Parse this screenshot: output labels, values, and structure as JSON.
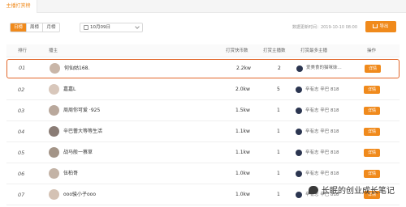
{
  "tabs": [
    {
      "label": "主播打赏榜"
    }
  ],
  "toolbar": {
    "period_options": [
      "日榜",
      "周榜",
      "月榜"
    ],
    "active_period": "日榜",
    "date_value": "10月09日",
    "update_text": "数据更新时间：2019-10-10 08:00",
    "export_label": "导出"
  },
  "table": {
    "headers": [
      "排行",
      "播主",
      "打赏快币数",
      "打赏主播数",
      "打赏最多主播",
      "操作"
    ],
    "rows": [
      {
        "rank": "01",
        "name": "何仙姑168.",
        "coins": "2.2kw",
        "count": "2",
        "top_host": "爱美食的猫咪妹...",
        "action": "详情"
      },
      {
        "rank": "02",
        "name": "嘉嘉L",
        "coins": "2.0kw",
        "count": "5",
        "top_host": "辛有志 辛巴 818",
        "action": "详情"
      },
      {
        "rank": "03",
        "name": "周周你可爱 ·925",
        "coins": "1.5kw",
        "count": "1",
        "top_host": "辛有志 辛巴 818",
        "action": "详情"
      },
      {
        "rank": "04",
        "name": "辛巴蕾大等等生活",
        "coins": "1.1kw",
        "count": "1",
        "top_host": "辛有志 辛巴 818",
        "action": "详情"
      },
      {
        "rank": "05",
        "name": "战马般一蔡草",
        "coins": "1.1kw",
        "count": "1",
        "top_host": "辛有志 辛巴 818",
        "action": "详情"
      },
      {
        "rank": "06",
        "name": "伍柏哥",
        "coins": "1.0kw",
        "count": "1",
        "top_host": "辛有志 辛巴 818",
        "action": "详情"
      },
      {
        "rank": "07",
        "name": "ooo骏小子ooo",
        "coins": "1.0kw",
        "count": "1",
        "top_host": "辛有志 辛巴 818",
        "action": "详情"
      }
    ]
  },
  "watermark": {
    "text": "长眠的创业成长笔记"
  },
  "colors": {
    "accent": "#f08a1c",
    "highlight_border": "#e2662a"
  }
}
